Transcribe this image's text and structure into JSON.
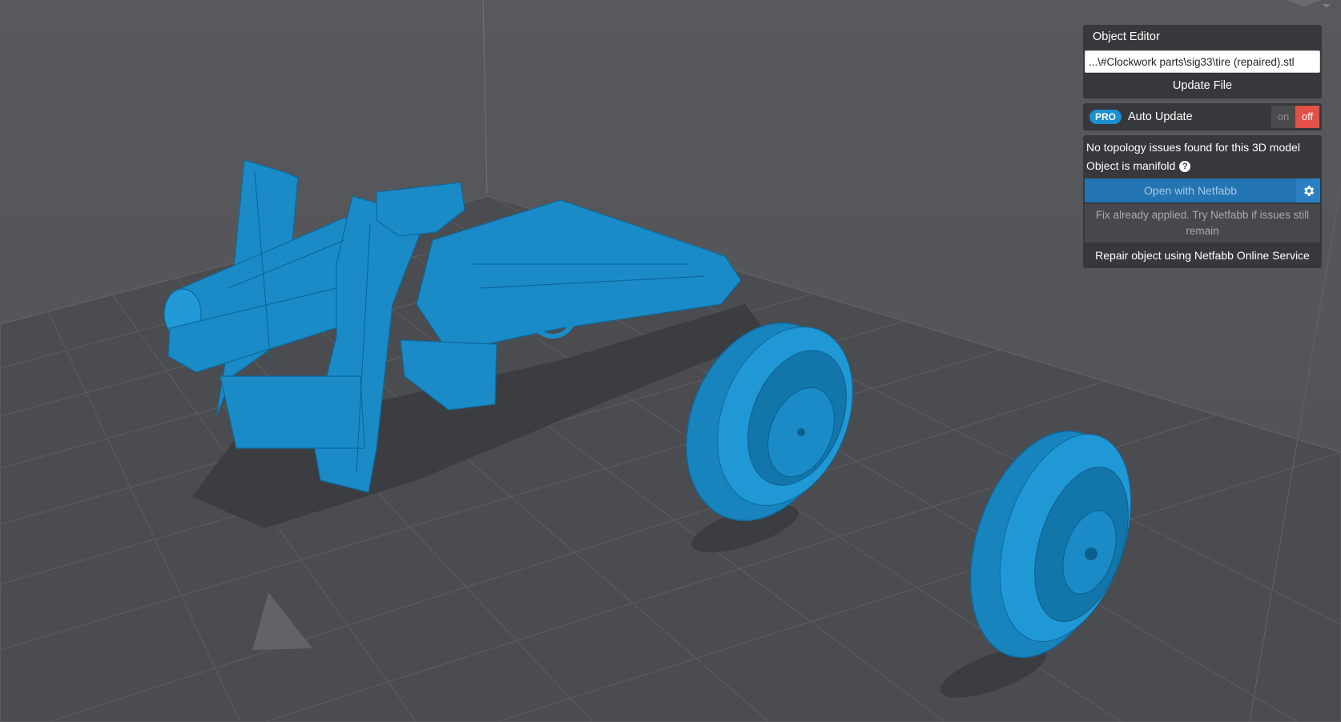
{
  "object_editor": {
    "title": "Object Editor",
    "file_path": "...\\#Clockwork parts\\sig33\\tire (repaired).stl",
    "update_file_label": "Update File"
  },
  "auto_update": {
    "badge": "PRO",
    "label": "Auto Update",
    "on_label": "on",
    "off_label": "off",
    "state": "off"
  },
  "topology": {
    "status_line": "No topology issues found for this 3D model",
    "manifold_line": "Object is manifold",
    "help_icon": "question-circle-icon",
    "open_netfabb_label": "Open with Netfabb",
    "settings_icon": "gear-icon",
    "fix_note": "Fix already applied. Try Netfabb if issues still remain",
    "repair_label": "Repair object using Netfabb Online Service"
  },
  "colors": {
    "background": "#55565a",
    "model": "#1a8bc7",
    "panel": "#37383b",
    "accent_blue": "#2374b3",
    "off_red": "#e35045"
  }
}
